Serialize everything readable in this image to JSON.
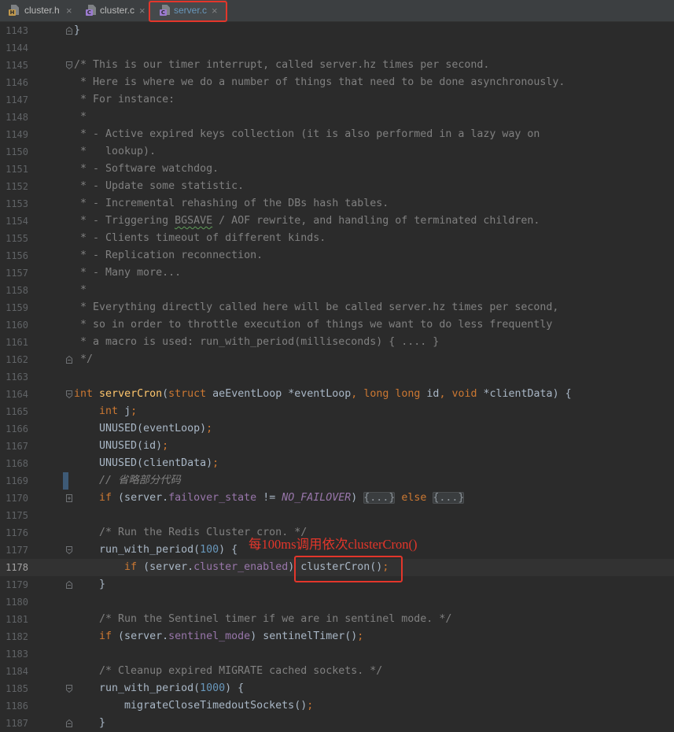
{
  "theme": {
    "editor_bg": "#2b2b2b",
    "tab_bar_bg": "#3c3f41",
    "active_tab_bg": "#45494b",
    "tab_text": "#bbbbbb",
    "text": "#a9b7c6",
    "line_number": "#606366",
    "current_line_number": "#a4a3a3",
    "current_line_bg": "#323232",
    "vcs_modified": "#3e5a76",
    "fold_marker": "#6f7275",
    "fold_placeholder_bg": "#3a3d3f",
    "typo_underline": "#5f9e59",
    "annotation_red": "#e3362b",
    "h_icon": "#c39a4d",
    "c_icon": "#9c7bd1"
  },
  "tabs": [
    {
      "label": "cluster.h",
      "icon": "h-file-icon",
      "icon_letter": "H",
      "close": "×",
      "active": false
    },
    {
      "label": "cluster.c",
      "icon": "c-file-icon",
      "icon_letter": "C",
      "close": "×",
      "active": false
    },
    {
      "label": "server.c",
      "icon": "c-file-icon",
      "icon_letter": "C",
      "close": "×",
      "active": true,
      "color": "#6897bb"
    }
  ],
  "editor": {
    "lines": [
      {
        "n": 1143,
        "fold": "fold-end-icon",
        "tokens": [
          {
            "t": "}"
          }
        ]
      },
      {
        "n": 1144,
        "tokens": []
      },
      {
        "n": 1145,
        "fold": "fold-start-icon",
        "tokens": [
          {
            "t": "/* This is our timer interrupt, called server.hz times per second.",
            "c": "#808080"
          }
        ]
      },
      {
        "n": 1146,
        "tokens": [
          {
            "t": " * Here is where we do a number of things that need to be done asynchronously.",
            "c": "#808080"
          }
        ]
      },
      {
        "n": 1147,
        "tokens": [
          {
            "t": " * For instance:",
            "c": "#808080"
          }
        ]
      },
      {
        "n": 1148,
        "tokens": [
          {
            "t": " *",
            "c": "#808080"
          }
        ]
      },
      {
        "n": 1149,
        "tokens": [
          {
            "t": " * - Active expired keys collection (it is also performed in a lazy way on",
            "c": "#808080"
          }
        ]
      },
      {
        "n": 1150,
        "tokens": [
          {
            "t": " *   lookup).",
            "c": "#808080"
          }
        ]
      },
      {
        "n": 1151,
        "tokens": [
          {
            "t": " * - Software watchdog.",
            "c": "#808080"
          }
        ]
      },
      {
        "n": 1152,
        "tokens": [
          {
            "t": " * - Update some statistic.",
            "c": "#808080"
          }
        ]
      },
      {
        "n": 1153,
        "tokens": [
          {
            "t": " * - Incremental rehashing of the DBs hash tables.",
            "c": "#808080"
          }
        ]
      },
      {
        "n": 1154,
        "tokens": [
          {
            "t": " * - Triggering ",
            "c": "#808080"
          },
          {
            "t": "BGSAVE",
            "c": "#808080",
            "typo": true
          },
          {
            "t": " / AOF rewrite, and handling of terminated children.",
            "c": "#808080"
          }
        ]
      },
      {
        "n": 1155,
        "tokens": [
          {
            "t": " * - Clients timeout of different kinds.",
            "c": "#808080"
          }
        ]
      },
      {
        "n": 1156,
        "tokens": [
          {
            "t": " * - Replication reconnection.",
            "c": "#808080"
          }
        ]
      },
      {
        "n": 1157,
        "tokens": [
          {
            "t": " * - Many more...",
            "c": "#808080"
          }
        ]
      },
      {
        "n": 1158,
        "tokens": [
          {
            "t": " *",
            "c": "#808080"
          }
        ]
      },
      {
        "n": 1159,
        "tokens": [
          {
            "t": " * Everything directly called here will be called server.hz times per second,",
            "c": "#808080"
          }
        ]
      },
      {
        "n": 1160,
        "tokens": [
          {
            "t": " * so in order to throttle execution of things we want to do less frequently",
            "c": "#808080"
          }
        ]
      },
      {
        "n": 1161,
        "tokens": [
          {
            "t": " * a macro is used: run_with_period(milliseconds) { .... }",
            "c": "#808080"
          }
        ]
      },
      {
        "n": 1162,
        "fold": "fold-end-icon",
        "tokens": [
          {
            "t": " */",
            "c": "#808080"
          }
        ]
      },
      {
        "n": 1163,
        "tokens": []
      },
      {
        "n": 1164,
        "fold": "fold-start-icon",
        "tokens": [
          {
            "t": "int",
            "c": "#cc7832"
          },
          {
            "t": " "
          },
          {
            "t": "serverCron",
            "c": "#ffc66d"
          },
          {
            "t": "("
          },
          {
            "t": "struct",
            "c": "#cc7832"
          },
          {
            "t": " aeEventLoop *eventLoop"
          },
          {
            "t": ",",
            "c": "#cc7832"
          },
          {
            "t": " "
          },
          {
            "t": "long",
            "c": "#cc7832"
          },
          {
            "t": " "
          },
          {
            "t": "long",
            "c": "#cc7832"
          },
          {
            "t": " id"
          },
          {
            "t": ",",
            "c": "#cc7832"
          },
          {
            "t": " "
          },
          {
            "t": "void",
            "c": "#cc7832"
          },
          {
            "t": " *clientData) {"
          }
        ]
      },
      {
        "n": 1165,
        "tokens": [
          {
            "t": "    "
          },
          {
            "t": "int",
            "c": "#cc7832"
          },
          {
            "t": " j"
          },
          {
            "t": ";",
            "c": "#cc7832"
          }
        ]
      },
      {
        "n": 1166,
        "tokens": [
          {
            "t": "    UNUSED(eventLoop)"
          },
          {
            "t": ";",
            "c": "#cc7832"
          }
        ]
      },
      {
        "n": 1167,
        "tokens": [
          {
            "t": "    UNUSED(id)"
          },
          {
            "t": ";",
            "c": "#cc7832"
          }
        ]
      },
      {
        "n": 1168,
        "tokens": [
          {
            "t": "    UNUSED(clientData)"
          },
          {
            "t": ";",
            "c": "#cc7832"
          }
        ]
      },
      {
        "n": 1169,
        "changed": true,
        "tokens": [
          {
            "t": "    "
          },
          {
            "t": "// 省略部分代码",
            "c": "#808080",
            "i": true
          }
        ]
      },
      {
        "n": 1170,
        "fold": "fold-expand-icon",
        "tokens": [
          {
            "t": "    "
          },
          {
            "t": "if",
            "c": "#cc7832"
          },
          {
            "t": " (server."
          },
          {
            "t": "failover_state",
            "c": "#9876aa"
          },
          {
            "t": " != "
          },
          {
            "t": "NO_FAILOVER",
            "c": "#9876aa",
            "i": true
          },
          {
            "t": ") "
          },
          {
            "t": "{...}",
            "fold": true
          },
          {
            "t": " "
          },
          {
            "t": "else",
            "c": "#cc7832"
          },
          {
            "t": " "
          },
          {
            "t": "{...}",
            "fold": true
          }
        ]
      },
      {
        "n": 1175,
        "tokens": []
      },
      {
        "n": 1176,
        "tokens": [
          {
            "t": "    "
          },
          {
            "t": "/* Run the Redis Cluster cron. */",
            "c": "#808080"
          }
        ]
      },
      {
        "n": 1177,
        "fold": "fold-start-icon",
        "tokens": [
          {
            "t": "    run_with_period("
          },
          {
            "t": "100",
            "c": "#6897bb"
          },
          {
            "t": ") {"
          }
        ]
      },
      {
        "n": 1178,
        "current": true,
        "tokens": [
          {
            "t": "        "
          },
          {
            "t": "if",
            "c": "#cc7832"
          },
          {
            "t": " (server."
          },
          {
            "t": "cluster_enabled",
            "c": "#9876aa"
          },
          {
            "t": ") clusterCron()"
          },
          {
            "t": ";",
            "c": "#cc7832"
          }
        ]
      },
      {
        "n": 1179,
        "fold": "fold-end-icon",
        "tokens": [
          {
            "t": "    }"
          }
        ]
      },
      {
        "n": 1180,
        "tokens": []
      },
      {
        "n": 1181,
        "tokens": [
          {
            "t": "    "
          },
          {
            "t": "/* Run the Sentinel timer if we are in sentinel mode. */",
            "c": "#808080"
          }
        ]
      },
      {
        "n": 1182,
        "tokens": [
          {
            "t": "    "
          },
          {
            "t": "if",
            "c": "#cc7832"
          },
          {
            "t": " (server."
          },
          {
            "t": "sentinel_mode",
            "c": "#9876aa"
          },
          {
            "t": ") sentinelTimer()"
          },
          {
            "t": ";",
            "c": "#cc7832"
          }
        ]
      },
      {
        "n": 1183,
        "tokens": []
      },
      {
        "n": 1184,
        "tokens": [
          {
            "t": "    "
          },
          {
            "t": "/* Cleanup expired MIGRATE cached sockets. */",
            "c": "#808080"
          }
        ]
      },
      {
        "n": 1185,
        "fold": "fold-start-icon",
        "tokens": [
          {
            "t": "    run_with_period("
          },
          {
            "t": "1000",
            "c": "#6897bb"
          },
          {
            "t": ") {"
          }
        ]
      },
      {
        "n": 1186,
        "tokens": [
          {
            "t": "        migrateCloseTimedoutSockets()"
          },
          {
            "t": ";",
            "c": "#cc7832"
          }
        ]
      },
      {
        "n": 1187,
        "fold": "fold-end-icon",
        "tokens": [
          {
            "t": "    }"
          }
        ]
      }
    ]
  },
  "annotation": {
    "text": "每100ms调用依次clusterCron()"
  }
}
